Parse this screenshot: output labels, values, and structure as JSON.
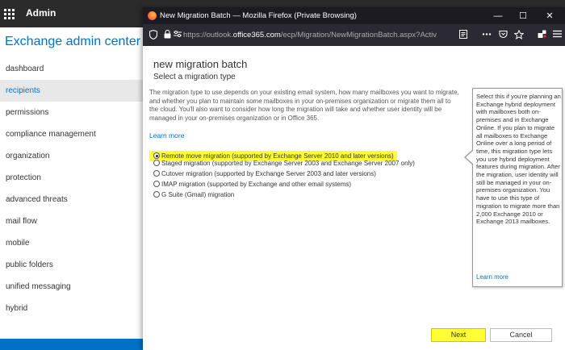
{
  "topbar": {
    "title": "Admin"
  },
  "sidebar": {
    "title": "Exchange admin center",
    "items": [
      {
        "label": "dashboard"
      },
      {
        "label": "recipients",
        "active": true
      },
      {
        "label": "permissions"
      },
      {
        "label": "compliance management"
      },
      {
        "label": "organization"
      },
      {
        "label": "protection"
      },
      {
        "label": "advanced threats"
      },
      {
        "label": "mail flow"
      },
      {
        "label": "mobile"
      },
      {
        "label": "public folders"
      },
      {
        "label": "unified messaging"
      },
      {
        "label": "hybrid"
      }
    ]
  },
  "browser": {
    "window_title": "New Migration Batch — Mozilla Firefox (Private Browsing)",
    "url_prefix": "https://outlook.",
    "url_domain": "office365.com",
    "url_path": "/ecp/Migration/NewMigrationBatch.aspx?Activ",
    "minimize": "—",
    "maximize": "☐",
    "close": "✕"
  },
  "dialog": {
    "title": "new migration batch",
    "subtitle": "Select a migration type",
    "description": "The migration type to use depends on your existing email system, how many mailboxes you want to migrate, and whether you plan to maintain some mailboxes in your on-premises organization or migrate them all to the cloud. You'll also want to consider how long the migration will take and whether user identity will be managed in your on-premises organization or in Office 365.",
    "learn_more": "Learn more",
    "options": [
      {
        "label": "Remote move migration (supported by Exchange Server 2010 and later versions)",
        "selected": true
      },
      {
        "label": "Staged migration (supported by Exchange Server 2003 and Exchange Server 2007 only)",
        "selected": false
      },
      {
        "label": "Cutover migration (supported by Exchange Server 2003 and later versions)",
        "selected": false
      },
      {
        "label": "IMAP migration (supported by Exchange and other email systems)",
        "selected": false
      },
      {
        "label": "G Suite (Gmail) migration",
        "selected": false
      }
    ],
    "callout": {
      "text": "Select this if you're planning an Exchange hybrid deployment with mailboxes both on-premises and in Exchange Online. If you plan to migrate all mailboxes to Exchange Online over a long period of time, this migration type lets you use hybrid deployment features during migration. After the migration, user identity will still be managed in your on-premises organization. You have to use this type of migration to migrate more than 2,000 Exchange 2010 or Exchange 2013 mailboxes.",
      "link": "Learn more"
    },
    "next_label": "Next",
    "cancel_label": "Cancel"
  },
  "colors": {
    "accent": "#0072c6",
    "highlight": "#ffff33",
    "topbar": "#2b2b2b",
    "browser_chrome": "#1c1b22"
  },
  "icons": [
    "waffle-icon",
    "firefox-logo-icon",
    "shield-icon",
    "lock-icon",
    "permissions-icon",
    "reader-view-icon",
    "more-icon",
    "pocket-icon",
    "star-icon",
    "extensions-icon",
    "menu-icon"
  ]
}
